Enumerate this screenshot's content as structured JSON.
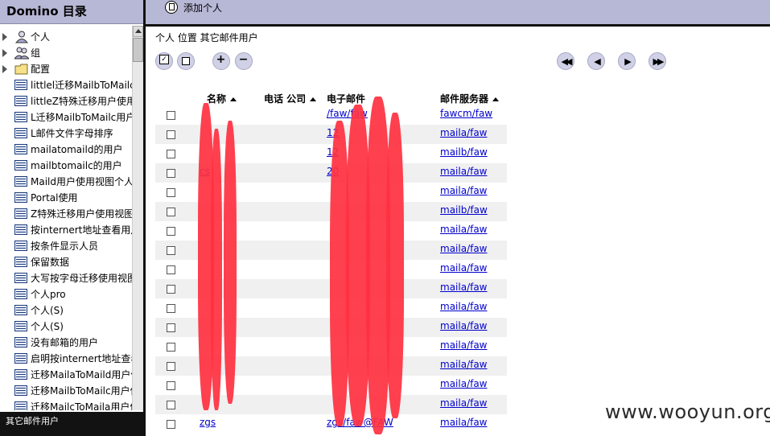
{
  "left_panel": {
    "title": "Domino 目录",
    "tree": [
      {
        "label": "个人",
        "icon": "person-icon"
      },
      {
        "label": "组",
        "icon": "group-icon"
      },
      {
        "label": "配置",
        "icon": "folder-icon"
      }
    ],
    "views": [
      "littlel迁移MailbToMailc用",
      "littleZ特殊迁移用户使用",
      "L迁移MailbToMailc用户",
      "L邮件文件字母排序",
      "mailatomaild的用户",
      "mailbtomailc的用户",
      "Maild用户使用视图个人",
      "Portal使用",
      "Z特殊迁移用户使用视图",
      "按internert地址查看用户",
      "按条件显示人员",
      "保留数据",
      "大写按字母迁移使用视图",
      "个人pro",
      "个人(S)",
      "个人(S)",
      "没有邮箱的用户",
      "启明按internert地址查看",
      "迁移MailaToMaild用户使",
      "迁移MailbToMailc用户使",
      "迁移MailcToMaila用户使"
    ],
    "footer": "其它邮件用户"
  },
  "toolbar": {
    "add_person": "添加个人"
  },
  "view": {
    "title": "个人 位置 其它邮件用户",
    "columns": {
      "name": "名称",
      "phone_company": "电话 公司",
      "email": "电子邮件",
      "server": "邮件服务器"
    },
    "rows": [
      {
        "name": "",
        "email": "/faw/faw",
        "server": "fawcm/faw"
      },
      {
        "name": "",
        "email": "12",
        "server": "maila/faw"
      },
      {
        "name": "",
        "email": "12",
        "server": "mailb/faw"
      },
      {
        "name": "cs",
        "email": "20",
        "server": "maila/faw"
      },
      {
        "name": "",
        "email": "",
        "server": "maila/faw"
      },
      {
        "name": "",
        "email": "",
        "server": "mailb/faw"
      },
      {
        "name": "",
        "email": "",
        "server": "maila/faw"
      },
      {
        "name": "",
        "email": "",
        "server": "maila/faw"
      },
      {
        "name": "",
        "email": "",
        "server": "maila/faw"
      },
      {
        "name": "",
        "email": "",
        "server": "maila/faw"
      },
      {
        "name": "",
        "email": "",
        "server": "maila/faw"
      },
      {
        "name": "",
        "email": "",
        "server": "maila/faw"
      },
      {
        "name": "",
        "email": "",
        "server": "maila/faw"
      },
      {
        "name": "",
        "email": "",
        "server": "maila/faw"
      },
      {
        "name": "",
        "email": "",
        "server": "maila/faw"
      },
      {
        "name": "",
        "email": "",
        "server": "maila/faw"
      },
      {
        "name": "zgs",
        "email": "zgs/faw@FAW",
        "server": "maila/faw"
      }
    ]
  },
  "watermark": "www.wooyun.org",
  "colors": {
    "header_bg": "#b7b7d6",
    "link": "#0000cc",
    "redaction": "#ff3040"
  }
}
